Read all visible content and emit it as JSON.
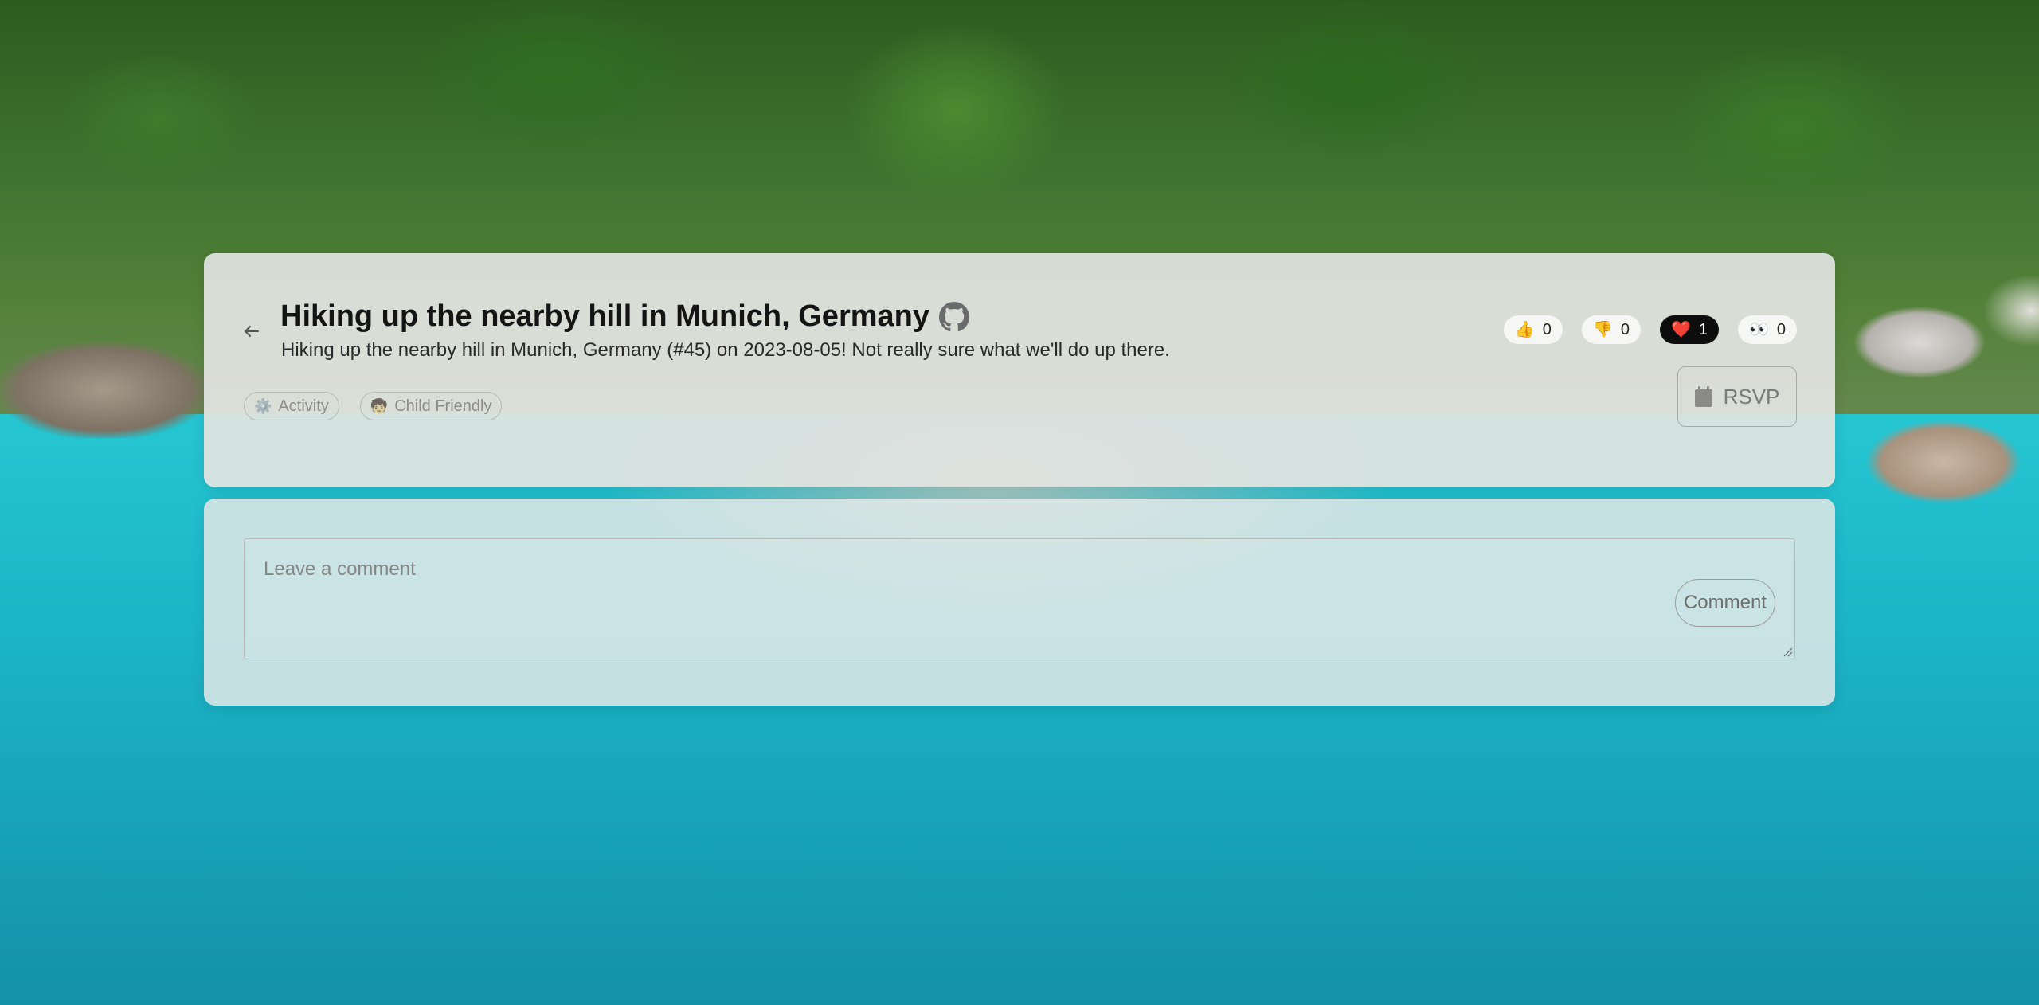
{
  "event": {
    "title": "Hiking up the nearby hill in Munich, Germany",
    "subtitle": "Hiking up the nearby hill in Munich, Germany (#45) on 2023-08-05! Not really sure what we'll do up there.",
    "tags": [
      {
        "icon": "gear-emoji",
        "emoji": "⚙️",
        "label": "Activity"
      },
      {
        "icon": "child-emoji",
        "emoji": "🧒",
        "label": "Child Friendly"
      }
    ],
    "reactions": [
      {
        "icon": "thumbs-up-icon",
        "emoji": "👍",
        "count": "0",
        "active": false
      },
      {
        "icon": "thumbs-down-icon",
        "emoji": "👎",
        "count": "0",
        "active": false
      },
      {
        "icon": "heart-icon",
        "emoji": "❤️",
        "count": "1",
        "active": true
      },
      {
        "icon": "eyes-icon",
        "emoji": "👀",
        "count": "0",
        "active": false
      }
    ],
    "rsvp_label": "RSVP"
  },
  "comment": {
    "placeholder": "Leave a comment",
    "submit_label": "Comment"
  },
  "colors": {
    "card_bg": "#e2e4e1",
    "active_reaction_bg": "#0d0d0d",
    "title": "#141414"
  }
}
